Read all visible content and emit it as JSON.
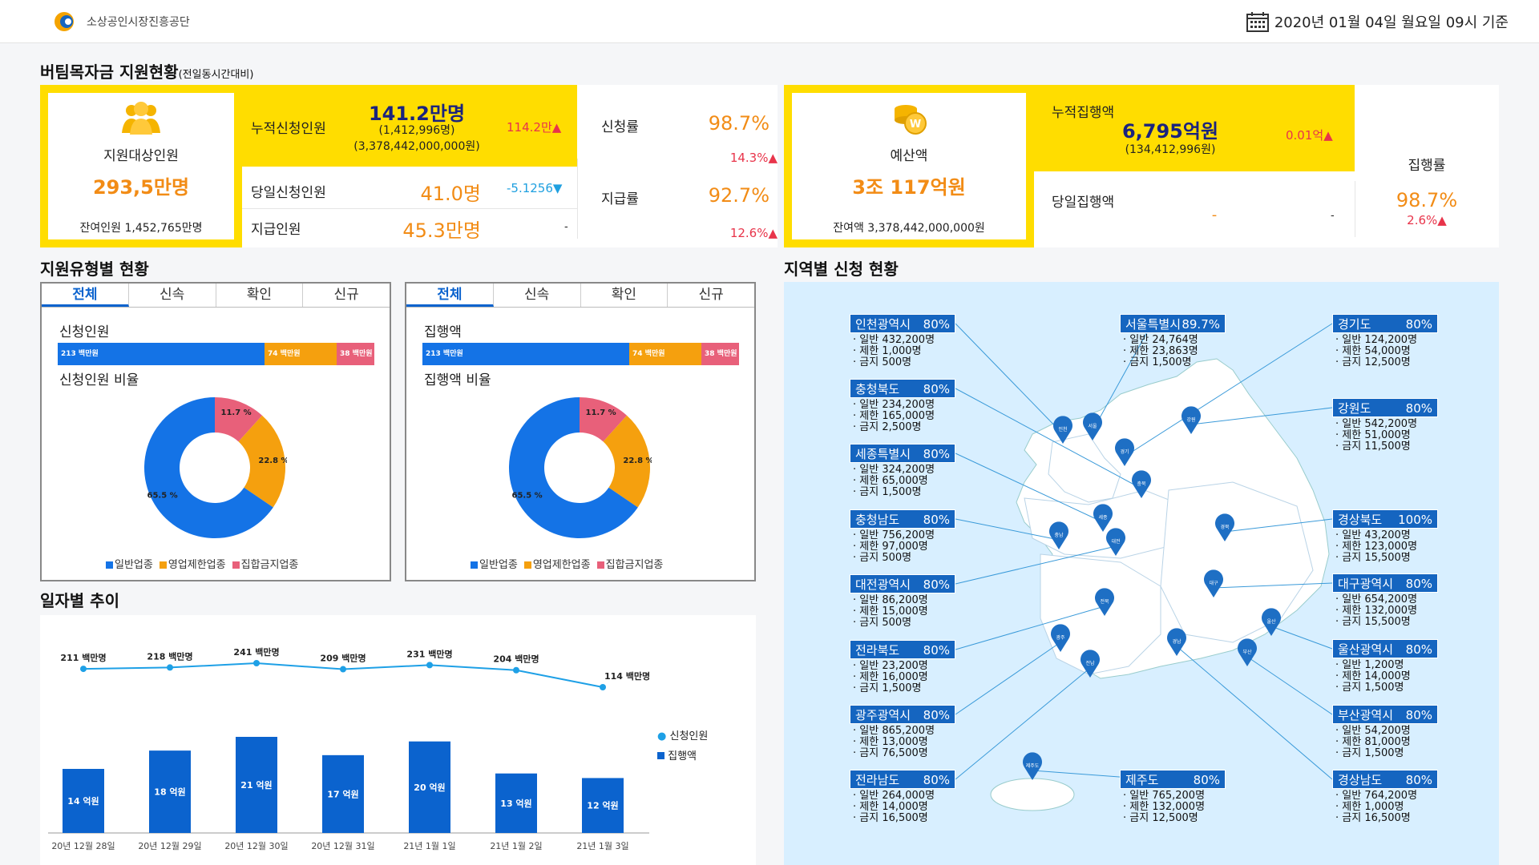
{
  "header": {
    "org_name": "소상공인시장진흥공단",
    "date_text": "2020년 01월 04일 월요일 09시 기준"
  },
  "summary": {
    "title": "버팀목자금 지원현황",
    "subtitle": "(전일동시간대비)",
    "target": {
      "label": "지원대상인원",
      "value": "293,5만명",
      "remain": "잔여인원 1,452,765만명"
    },
    "cum_apply": {
      "label": "누적신청인원",
      "value": "141.2만명",
      "sub1": "(1,412,996명)",
      "sub2": "(3,378,442,000,000원)",
      "delta": "114.2만▲"
    },
    "day_apply": {
      "label": "당일신청인원",
      "value": "41.0명",
      "delta": "-5.1256▼"
    },
    "paid": {
      "label": "지급인원",
      "value": "45.3만명",
      "delta": "-"
    },
    "apply_rate": {
      "label": "신청률",
      "value": "98.7%",
      "delta": "14.3%▲"
    },
    "pay_rate": {
      "label": "지급률",
      "value": "92.7%",
      "delta": "12.6%▲"
    },
    "budget": {
      "label": "예산액",
      "value": "3조 117억원",
      "remain": "잔여액 3,378,442,000,000원"
    },
    "cum_exec": {
      "label": "누적집행액",
      "value": "6,795억원",
      "sub": "(134,412,996원)",
      "delta": "0.01억▲"
    },
    "day_exec": {
      "label": "당일집행액",
      "value": "-",
      "delta": "-"
    },
    "exec_rate": {
      "label": "집행률",
      "value": "98.7%",
      "delta": "2.6%▲"
    }
  },
  "type_section": {
    "title": "지원유형별 현황",
    "tabs": [
      "전체",
      "신속",
      "확인",
      "신규"
    ],
    "left": {
      "bar_title": "신청인원",
      "bars": [
        "213 백만원",
        "74 백만원",
        "38 백만원"
      ],
      "donut_title": "신청인원 비율"
    },
    "right": {
      "bar_title": "집행액",
      "bars": [
        "213 백만원",
        "74 백만원",
        "38 백만원"
      ],
      "donut_title": "집행액 비율"
    },
    "legend": [
      "일반업종",
      "영업제한업종",
      "집합금지업종"
    ],
    "colors": [
      "#1473e6",
      "#f5a00e",
      "#e8607a"
    ]
  },
  "chart_data": {
    "type": "bar",
    "title": "일자별 추이",
    "categories": [
      "20년 12월 28일",
      "20년 12월 29일",
      "20년 12월 30일",
      "20년 12월 31일",
      "21년 1월 1일",
      "21년 1월 2일",
      "21년 1월 3일"
    ],
    "series": [
      {
        "name": "신청인원",
        "kind": "line",
        "values": [
          211,
          218,
          241,
          209,
          231,
          204,
          114
        ],
        "labels": [
          "211 백만명",
          "218 백만명",
          "241 백만명",
          "209 백만명",
          "231 백만명",
          "204 백만명",
          "114 백만명"
        ]
      },
      {
        "name": "집행액",
        "kind": "bar",
        "values": [
          14,
          18,
          21,
          17,
          20,
          13,
          12
        ],
        "labels": [
          "14 억원",
          "18 억원",
          "21 억원",
          "17 억원",
          "20 억원",
          "13 억원",
          "12 억원"
        ]
      }
    ],
    "donut": {
      "values": [
        65.5,
        22.8,
        11.7
      ],
      "labels": [
        "65.5 %",
        "22.8 %",
        "11.7 %"
      ]
    }
  },
  "region_section": {
    "title": "지역별 신청 현황",
    "regions": [
      {
        "name": "인천광역시",
        "pct": "80%",
        "lines": [
          "일반 432,200명",
          "제한 1,000명",
          "금지 500명"
        ]
      },
      {
        "name": "충청북도",
        "pct": "80%",
        "lines": [
          "일반 234,200명",
          "제한 165,000명",
          "금지 2,500명"
        ]
      },
      {
        "name": "세종특별시",
        "pct": "80%",
        "lines": [
          "일반 324,200명",
          "제한 65,000명",
          "금지 1,500명"
        ]
      },
      {
        "name": "충청남도",
        "pct": "80%",
        "lines": [
          "일반 756,200명",
          "제한 97,000명",
          "금지 500명"
        ]
      },
      {
        "name": "대전광역시",
        "pct": "80%",
        "lines": [
          "일반 86,200명",
          "제한 15,000명",
          "금지 500명"
        ]
      },
      {
        "name": "전라북도",
        "pct": "80%",
        "lines": [
          "일반 23,200명",
          "제한 16,000명",
          "금지 1,500명"
        ]
      },
      {
        "name": "광주광역시",
        "pct": "80%",
        "lines": [
          "일반 865,200명",
          "제한 13,000명",
          "금지 76,500명"
        ]
      },
      {
        "name": "전라남도",
        "pct": "80%",
        "lines": [
          "일반 264,000명",
          "제한 14,000명",
          "금지 16,500명"
        ]
      },
      {
        "name": "서울특별시",
        "pct": "89.7%",
        "lines": [
          "일반 24,764명",
          "제한 23,863명",
          "금지 1,500명"
        ]
      },
      {
        "name": "제주도",
        "pct": "80%",
        "lines": [
          "일반 765,200명",
          "제한 132,000명",
          "금지 12,500명"
        ]
      },
      {
        "name": "경기도",
        "pct": "80%",
        "lines": [
          "일반 124,200명",
          "제한 54,000명",
          "금지 12,500명"
        ]
      },
      {
        "name": "강원도",
        "pct": "80%",
        "lines": [
          "일반 542,200명",
          "제한 51,000명",
          "금지 11,500명"
        ]
      },
      {
        "name": "경상북도",
        "pct": "100%",
        "lines": [
          "일반 43,200명",
          "제한 123,000명",
          "금지 15,500명"
        ]
      },
      {
        "name": "대구광역시",
        "pct": "80%",
        "lines": [
          "일반 654,200명",
          "제한 132,000명",
          "금지 15,500명"
        ]
      },
      {
        "name": "울산광역시",
        "pct": "80%",
        "lines": [
          "일반 1,200명",
          "제한 14,000명",
          "금지 1,500명"
        ]
      },
      {
        "name": "부산광역시",
        "pct": "80%",
        "lines": [
          "일반 54,200명",
          "제한 81,000명",
          "금지 1,500명"
        ]
      },
      {
        "name": "경상남도",
        "pct": "80%",
        "lines": [
          "일반 764,200명",
          "제한 1,000명",
          "금지 16,500명"
        ]
      }
    ],
    "pins": [
      "인천",
      "서울",
      "경기",
      "강원",
      "세종",
      "충북",
      "충남",
      "대전",
      "경북",
      "대구",
      "전북",
      "울산",
      "광주",
      "경남",
      "전남",
      "부산",
      "제주도"
    ]
  }
}
